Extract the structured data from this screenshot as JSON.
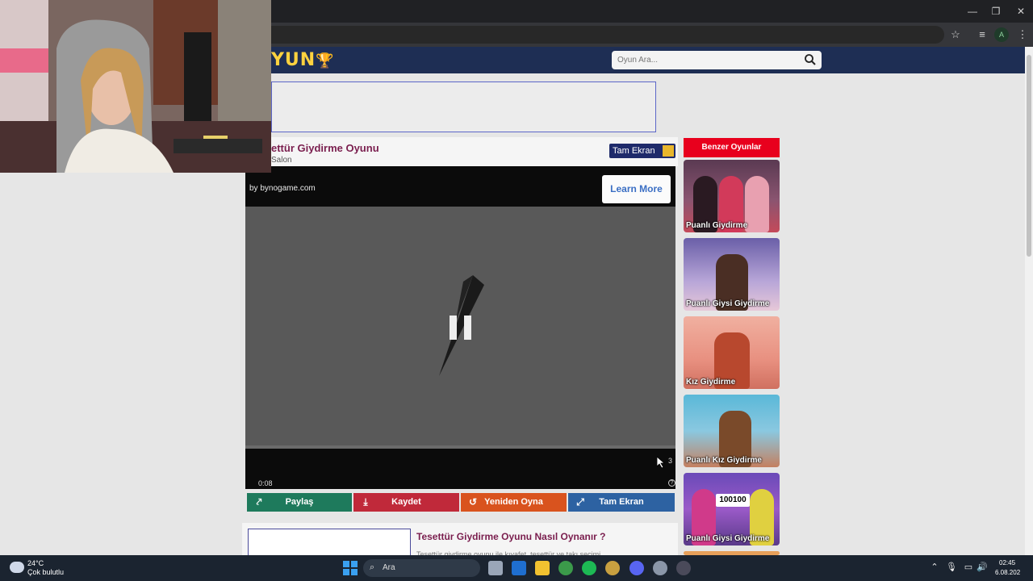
{
  "browser": {
    "window_controls": {
      "minimize": "—",
      "restore": "❐",
      "close": "✕"
    },
    "profile_initial": "A"
  },
  "site": {
    "logo_text": "YUN",
    "search_placeholder": "Oyun Ara..."
  },
  "game": {
    "title": "ettür Giydirme Oyunu",
    "subtitle": "Salon",
    "fullscreen_label": "Tam Ekran",
    "ad": {
      "by_text": "by bynogame.com",
      "learn_more": "Learn More",
      "time": "0:08",
      "skip_count": "3",
      "help": "?"
    },
    "actions": [
      {
        "label": "Paylaş",
        "color": "#1e7a5c",
        "icon": "share-icon"
      },
      {
        "label": "Kaydet",
        "color": "#c0293a",
        "icon": "download-icon"
      },
      {
        "label": "Yeniden Oyna",
        "color": "#d9531e",
        "icon": "replay-icon"
      },
      {
        "label": "Tam Ekran",
        "color": "#2d62a2",
        "icon": "expand-icon"
      }
    ]
  },
  "howto": {
    "title": "Tesettür Giydirme Oyunu Nasıl Oynanır ?",
    "text": "Tesettür giydirme oyunu ile kıyafet, tesettür ve takı seçimi..."
  },
  "sidebar": {
    "heading": "Benzer Oyunlar",
    "games": [
      {
        "label": "Puanlı Giydirme"
      },
      {
        "label": "Puanlı Giysi Giydirme"
      },
      {
        "label": "Kız Giydirme"
      },
      {
        "label": "Puanlı Kız Giydirme"
      },
      {
        "label": "Puanlı Giysi Giydirme"
      }
    ],
    "thumb_badge": "100"
  },
  "taskbar": {
    "weather_temp": "24°C",
    "weather_desc": "Çok bulutlu",
    "search_label": "Ara",
    "time": "02:45",
    "date": "6.08.202"
  },
  "colors": {
    "header_bg": "#1e2e54",
    "accent_red": "#e8001d",
    "title_color": "#7a1e4e"
  }
}
